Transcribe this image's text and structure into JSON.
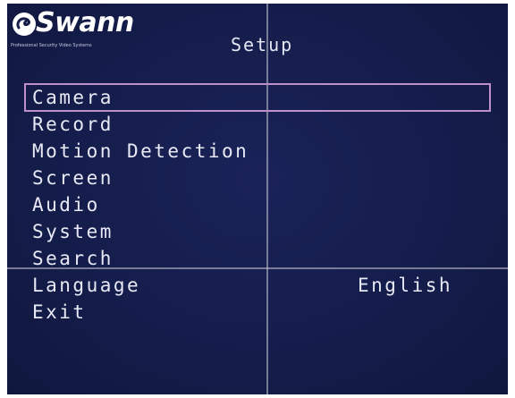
{
  "brand": {
    "name": "Swann",
    "tagline": "Professional Security Video Systems",
    "logo_icon": "swann-logo-icon"
  },
  "screen": {
    "title": "Setup"
  },
  "menu": {
    "items": [
      {
        "label": "Camera",
        "selected": true
      },
      {
        "label": "Record"
      },
      {
        "label": "Motion Detection"
      },
      {
        "label": "Screen"
      },
      {
        "label": "Audio"
      },
      {
        "label": "System"
      },
      {
        "label": "Search"
      },
      {
        "label": "Language",
        "value": "English"
      },
      {
        "label": "Exit"
      }
    ]
  },
  "colors": {
    "background": "#141c4a",
    "selection_outline": "#c08ec8",
    "text": "#e8e9f5"
  }
}
